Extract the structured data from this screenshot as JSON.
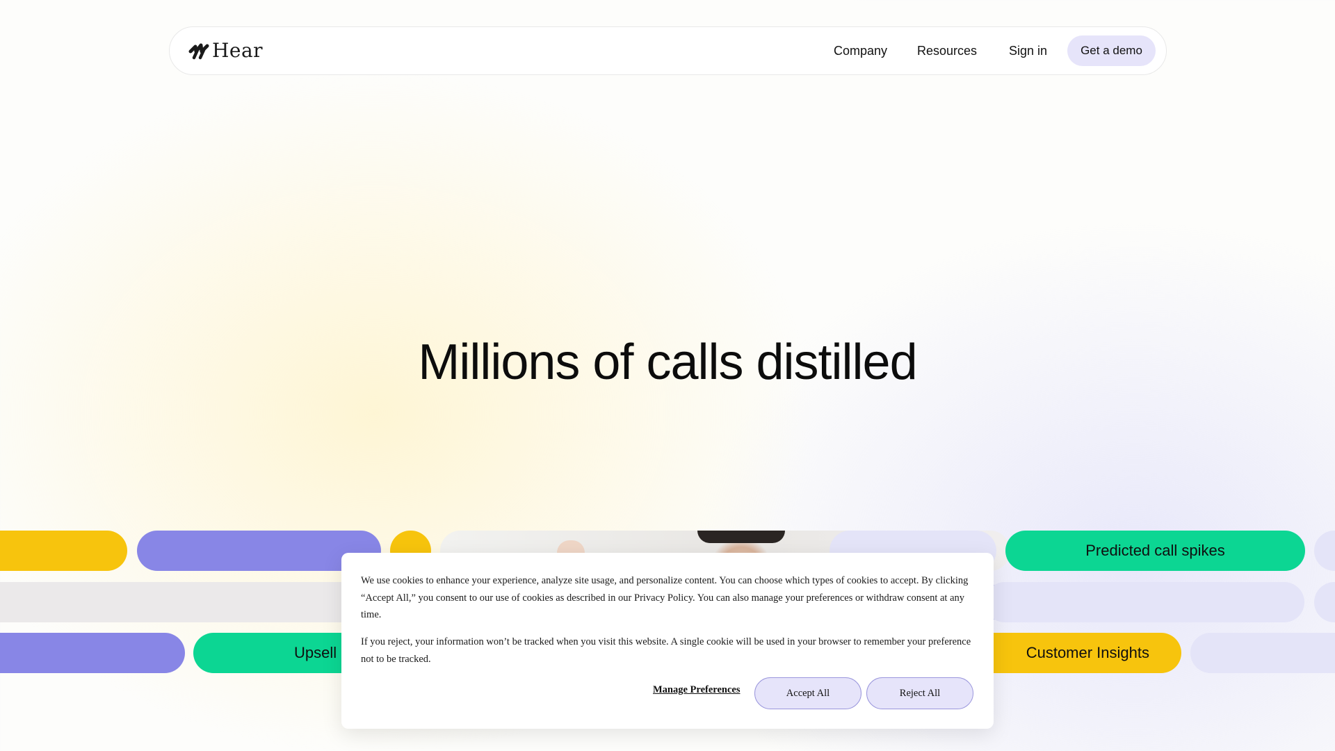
{
  "header": {
    "logo_text": "Hear",
    "nav": {
      "company": "Company",
      "resources": "Resources",
      "sign_in": "Sign in",
      "demo": "Get a demo"
    }
  },
  "hero": {
    "title": "Millions of calls distilled"
  },
  "pills": {
    "upsell": "Upsell c",
    "predicted": "Predicted call spikes",
    "insights": "Customer Insights"
  },
  "cookie": {
    "paragraph1": "We use cookies to enhance your experience, analyze site usage, and personalize content. You can choose which types of cookies to accept. By clicking “Accept All,” you consent to our use of cookies as described in our Privacy Policy. You can also manage your preferences or withdraw consent at any time.",
    "paragraph2": "If you reject, your information won’t be tracked when you visit this website. A single cookie will be used in your browser to remember your preference not to be tracked.",
    "manage_label": "Manage Preferences",
    "accept_label": "Accept All",
    "reject_label": "Reject All"
  },
  "colors": {
    "yellow": "#f7c40d",
    "purple": "#8886e6",
    "green": "#0cd693",
    "lavender": "#e4e4f8",
    "button_bg": "#e6e4fa"
  }
}
